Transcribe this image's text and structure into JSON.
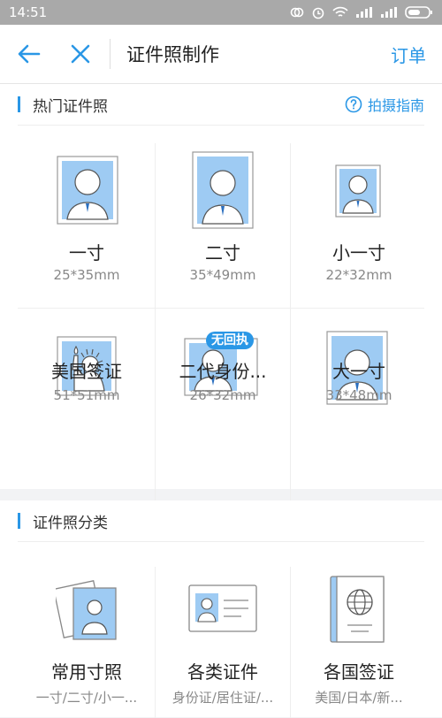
{
  "status": {
    "time": "14:51"
  },
  "nav": {
    "title": "证件照制作",
    "order": "订单"
  },
  "hot": {
    "title": "热门证件照",
    "guide": "拍摄指南",
    "items": [
      {
        "name": "一寸",
        "size": "25*35mm"
      },
      {
        "name": "二寸",
        "size": "35*49mm"
      },
      {
        "name": "小一寸",
        "size": "22*32mm"
      },
      {
        "name": "美国签证",
        "size": "51*51mm"
      },
      {
        "name": "二代身份...",
        "size": "26*32mm",
        "badge": "无回执"
      },
      {
        "name": "大一寸",
        "size": "33*48mm"
      }
    ]
  },
  "category": {
    "title": "证件照分类",
    "items": [
      {
        "name": "常用寸照",
        "desc": "一寸/二寸/小一..."
      },
      {
        "name": "各类证件",
        "desc": "身份证/居住证/..."
      },
      {
        "name": "各国签证",
        "desc": "美国/日本/新..."
      }
    ]
  },
  "colors": {
    "accent": "#2a97e6",
    "photo_bg": "#9ecbf3"
  }
}
